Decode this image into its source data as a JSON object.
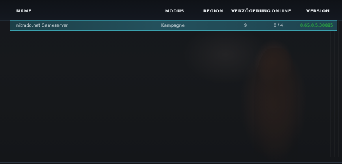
{
  "columns": {
    "name": "NAME",
    "mode": "MODUS",
    "region": "REGION",
    "delay": "VERZÖGERUNG",
    "online": "ONLINE",
    "version": "VERSION"
  },
  "servers": [
    {
      "name": "nitrado.net Gameserver",
      "mode": "Kampagne",
      "region": "",
      "delay": "9",
      "online": "0 / 4",
      "version": "0.65.0.5.30895"
    }
  ],
  "colors": {
    "row_highlight": "#24505c",
    "version_text": "#2fcf3a",
    "accent_line": "#3aa0ad"
  }
}
